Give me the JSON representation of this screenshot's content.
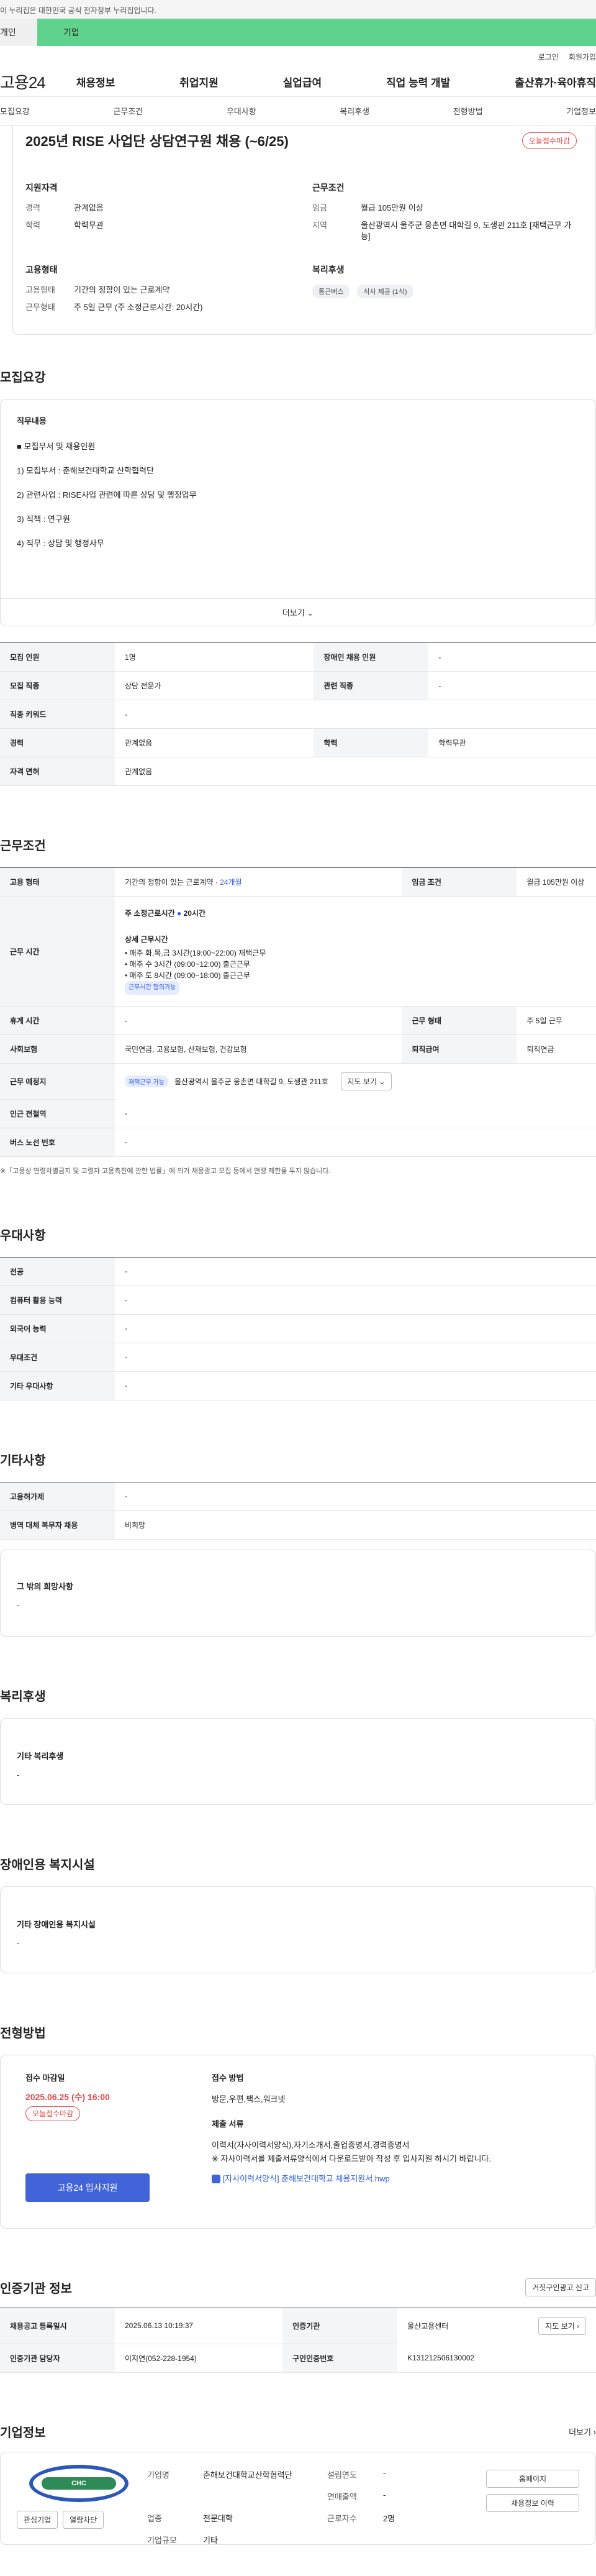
{
  "banner": {
    "text": "이 누리집은 대한민국 공식 전자정부 누리집입니다."
  },
  "top_tabs": {
    "tab1": "개인",
    "tab2": "기업"
  },
  "util": {
    "login": "로그인",
    "join": "회원가입"
  },
  "gnb": {
    "logo": "고용24",
    "menu": [
      "채용정보",
      "취업지원",
      "실업급여",
      "직업 능력 개발",
      "출산휴가·육아휴직"
    ]
  },
  "subtabs": [
    "모집요강",
    "근무조건",
    "우대사항",
    "복리후생",
    "전형방법",
    "기업정보"
  ],
  "job": {
    "title": "2025년 RISE 사업단 상담연구원 채용 (~6/25)",
    "badge": "오늘접수마감",
    "qual_title": "지원자격",
    "qual": [
      {
        "k": "경력",
        "v": "관계없음"
      },
      {
        "k": "학력",
        "v": "학력무관"
      }
    ],
    "cond_title": "근무조건",
    "cond": [
      {
        "k": "임금",
        "v": "월급 105만원 이상"
      },
      {
        "k": "지역",
        "v": "울산광역시 울주군 웅촌면 대학길 9, 도생관 211호 [재택근무 가능]"
      }
    ],
    "emp_title": "고용형태",
    "emp": [
      {
        "k": "고용형태",
        "v": "기간의 정함이 있는 근로계약"
      },
      {
        "k": "근무형태",
        "v": "주 5일 근무 (주 소정근로시간: 20시간)"
      }
    ],
    "welfare_title": "복리후생",
    "welfare_chips": [
      "통근버스",
      "식사 제공 (1식)"
    ]
  },
  "recruit": {
    "section": "모집요강",
    "duty_title": "직무내용",
    "lines": [
      "■ 모집부서 및 채용인원",
      "1) 모집부서 : 춘해보건대학교 산학협력단",
      "2) 관련사업 : RISE사업 관련에 따른 상담 및 행정업무",
      "3) 직책 : 연구원",
      "4) 직무 : 상담 및 행정사무"
    ],
    "more": "더보기 ⌄"
  },
  "recruit_table": [
    {
      "k1": "모집 인원",
      "v1": "1명",
      "k2": "장애인 채용 인원",
      "v2": "-"
    },
    {
      "k1": "모집 직종",
      "v1": "상담 전문가",
      "k2": "관련 직종",
      "v2": "-"
    },
    {
      "k1": "직종 키워드",
      "v1": "-",
      "k2": "",
      "v2": ""
    },
    {
      "k1": "경력",
      "v1": "관계없음",
      "k2": "학력",
      "v2": "학력무관"
    },
    {
      "k1": "자격 면허",
      "v1": "관계없음",
      "k2": "",
      "v2": ""
    }
  ],
  "work": {
    "section": "근무조건",
    "emp_type_k": "고용 형태",
    "emp_type_v": "기간의 정함이 있는 근로계약 · ",
    "emp_type_period": "24개월",
    "wage_k": "임금 조건",
    "wage_v": "월급 105만원 이상",
    "hours_k": "근무 시간",
    "hours_total": "주 소정근로시간",
    "hours_total_v": "20시간",
    "hours_detail_title": "상세 근무시간",
    "hours_lines": [
      "• 매주 화,목,금 3시간(19:00~22:00) 재택근무",
      "• 매주 수 3시간 (09:00~12:00) 출근근무",
      "• 매주 토 8시간 (09:00~18:00) 출근근무"
    ],
    "hours_badge": "근무시간 협의가능",
    "break_k": "휴게 시간",
    "break_v": "-",
    "form_k": "근무 형태",
    "form_v": "주 5일 근무",
    "ins_k": "사회보험",
    "ins_v": "국민연금, 고용보험, 산재보험, 건강보험",
    "retire_k": "퇴직급여",
    "retire_v": "퇴직연금",
    "place_k": "근무 예정지",
    "place_badge": "재택근무 가능",
    "place_v": "울산광역시 울주군 웅촌면 대학길 9, 도생관 211호",
    "map_btn": "지도 보기 ⌄",
    "subway_k": "인근 전철역",
    "subway_v": "-",
    "bus_k": "버스 노선 번호",
    "bus_v": "-",
    "note": "※「고용상 연령차별금지 및 고령자 고용촉진에 관한 법률」에 의거 채용광고 모집 등에서 연령 제한을 두지 않습니다."
  },
  "pref": {
    "section": "우대사항",
    "rows": [
      {
        "k": "전공",
        "v": "-"
      },
      {
        "k": "컴퓨터 활용 능력",
        "v": "-"
      },
      {
        "k": "외국어 능력",
        "v": "-"
      },
      {
        "k": "우대조건",
        "v": "-"
      },
      {
        "k": "기타 우대사항",
        "v": "-"
      }
    ]
  },
  "etc": {
    "section": "기타사항",
    "rows": [
      {
        "k": "고용허가제",
        "v": "-"
      },
      {
        "k": "병역 대체 복무자 채용",
        "v": "비희망"
      }
    ],
    "box_title": "그 밖의 희망사항",
    "box_v": "-"
  },
  "welfare": {
    "section": "복리후생",
    "box_title": "기타 복리후생",
    "box_v": "-"
  },
  "disabled": {
    "section": "장애인용 복지시설",
    "box_title": "기타 장애인용 복지시설",
    "box_v": "-"
  },
  "apply": {
    "section": "전형방법",
    "deadline_title": "접수 마감일",
    "deadline": "2025.06.25 (수) 16:00",
    "deadline_badge": "오늘접수마감",
    "method_title": "접수 방법",
    "method": "방문,우편,팩스,워크넷",
    "docs_title": "제출 서류",
    "docs_lines": [
      "이력서(자사이력서양식),자기소개서,졸업증명서,경력증명서",
      "※ 자사이력서를 제출서류양식에서 다운로드받아 작성 후 입사지원 하시기 바랍니다."
    ],
    "file": "[자사이력서양식] 춘해보건대학교 채용지원서.hwp",
    "apply_btn": "고용24 입사지원"
  },
  "cert": {
    "section": "인증기관 정보",
    "report_btn": "거짓구인광고 신고",
    "rows": [
      {
        "k1": "채용공고 등록일시",
        "v1": "2025.06.13 10:19:37",
        "k2": "인증기관",
        "v2": "울산고용센터",
        "btn": "지도 보기 ›"
      },
      {
        "k1": "인증기관 담당자",
        "v1": "이지연(052-228-1954)",
        "k2": "구인인증번호",
        "v2": "K131212506130002",
        "btn": ""
      }
    ]
  },
  "company": {
    "section": "기업정보",
    "more": "더보기 ›",
    "logo_text": "CHC",
    "fav_btn": "관심기업",
    "follow_btn": "열람차단",
    "name_k": "기업명",
    "name_v": "춘해보건대학교산학협력단",
    "founded_k": "설립연도",
    "founded_v": "-",
    "sales_k": "연매출액",
    "sales_v": "-",
    "industry_k": "업종",
    "industry_v": "전문대학",
    "staff_k": "근로자수",
    "staff_v": "2명",
    "size_k": "기업규모",
    "size_v": "기타",
    "home_btn": "홈페이지",
    "info_btn": "채용정보 이력"
  }
}
